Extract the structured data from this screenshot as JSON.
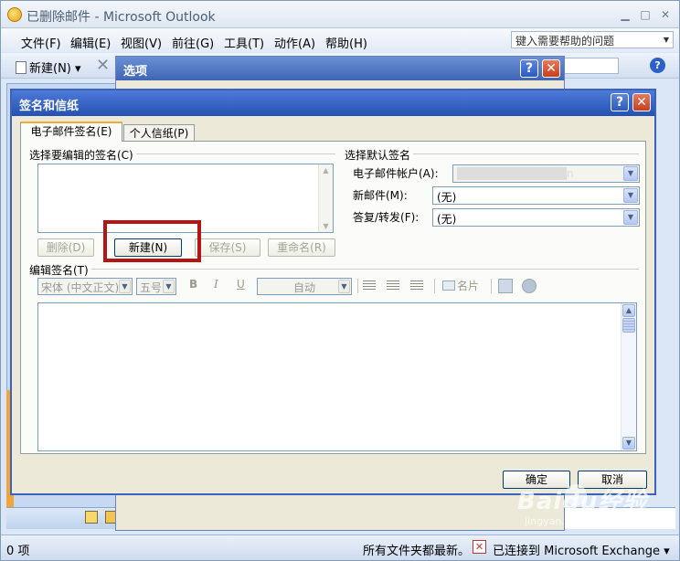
{
  "outlook": {
    "title": "已删除邮件 - Microsoft Outlook",
    "menu": [
      "文件(F)",
      "编辑(E)",
      "视图(V)",
      "前往(G)",
      "工具(T)",
      "动作(A)",
      "帮助(H)"
    ],
    "help_placeholder": "键入需要帮助的问题",
    "toolbar_new": "新建(N)",
    "status_count": "0 项",
    "status_folders": "所有文件夹都最新。",
    "status_exchange": "已连接到 Microsoft Exchange ▾"
  },
  "options_dialog": {
    "title": "选项"
  },
  "signatures_dialog": {
    "title": "签名和信纸",
    "tabs": {
      "email_signature": "电子邮件签名(E)",
      "personal_stationery": "个人信纸(P)"
    },
    "select_signature_label": "选择要编辑的签名(C)",
    "buttons": {
      "delete": "删除(D)",
      "new": "新建(N)",
      "save": "保存(S)",
      "rename": "重命名(R)",
      "ok": "确定",
      "cancel": "取消"
    },
    "default_signature": {
      "group_label": "选择默认签名",
      "account_label": "电子邮件帐户(A):",
      "account_value": "█████████████n",
      "new_messages_label": "新邮件(M):",
      "new_messages_value": "(无)",
      "replies_label": "答复/转发(F):",
      "replies_value": "(无)"
    },
    "edit_signature_label": "编辑签名(T)",
    "editor_toolbar": {
      "font": "宋体 (中文正文)",
      "size": "五号",
      "bold": "B",
      "italic": "I",
      "underline": "U",
      "color": "自动",
      "business_card": "名片"
    }
  },
  "watermark": {
    "main": "Baidu经验",
    "sub": "jingyan.baidu.com"
  },
  "colors": {
    "title_blue": "#2452b4",
    "highlight_red": "#b41414",
    "dialog_face": "#ece9d8"
  }
}
